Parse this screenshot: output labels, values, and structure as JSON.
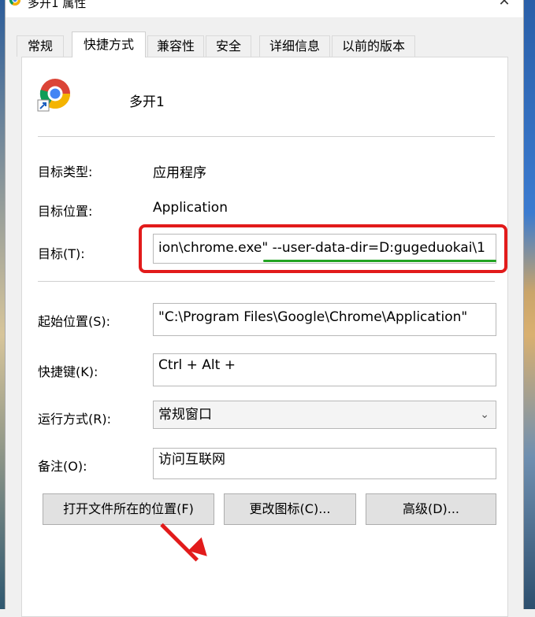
{
  "window": {
    "title": "多开1 属性",
    "close_icon": "close-icon"
  },
  "tabs": [
    {
      "label": "常规"
    },
    {
      "label": "快捷方式"
    },
    {
      "label": "兼容性"
    },
    {
      "label": "安全"
    },
    {
      "label": "详细信息"
    },
    {
      "label": "以前的版本"
    }
  ],
  "shortcut": {
    "name": "多开1",
    "icon": "chrome-icon",
    "target_type_label": "目标类型:",
    "target_type_value": "应用程序",
    "target_location_label": "目标位置:",
    "target_location_value": "Application",
    "target_label": "目标(T):",
    "target_value_normal": "ion\\chrome.exe\" ",
    "target_value_highlight": "--user-data-dir=D:gugeduokai\\1",
    "start_in_label": "起始位置(S):",
    "start_in_value": "\"C:\\Program Files\\Google\\Chrome\\Application\"",
    "hotkey_label": "快捷键(K):",
    "hotkey_value": "Ctrl + Alt +",
    "run_label": "运行方式(R):",
    "run_value": "常规窗口",
    "comment_label": "备注(O):",
    "comment_value": "访问互联网"
  },
  "buttons": {
    "open_location": "打开文件所在的位置(F)",
    "change_icon": "更改图标(C)...",
    "advanced": "高级(D)..."
  },
  "colors": {
    "annotation_red": "#e21b1b",
    "annotation_green": "#22a322"
  }
}
